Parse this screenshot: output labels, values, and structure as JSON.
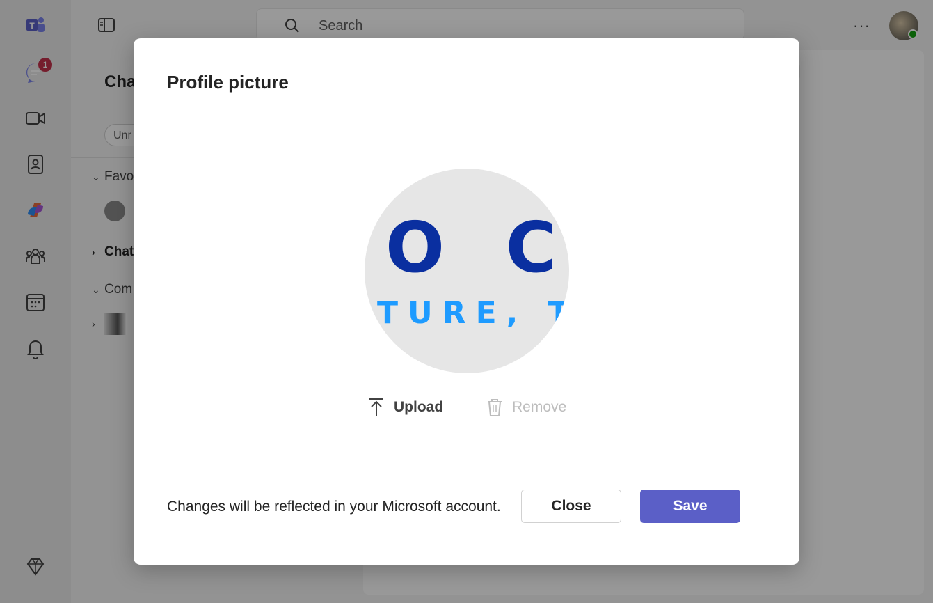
{
  "app": {
    "search": {
      "placeholder": "Search"
    },
    "more_label": "···",
    "chat_panel": {
      "title": "Cha",
      "filter_label": "Unr",
      "sections": [
        {
          "label": "Favo",
          "expanded": true
        },
        {
          "label": "Chat",
          "expanded": false
        },
        {
          "label": "Com",
          "expanded": true
        }
      ]
    },
    "rail": {
      "items": [
        {
          "name": "teams-logo-icon"
        },
        {
          "name": "chat-icon",
          "badge": "1"
        },
        {
          "name": "video-icon"
        },
        {
          "name": "contacts-icon"
        },
        {
          "name": "copilot-icon"
        },
        {
          "name": "communities-icon"
        },
        {
          "name": "calendar-icon"
        },
        {
          "name": "bell-icon"
        },
        {
          "name": "premium-icon"
        }
      ]
    }
  },
  "dialog": {
    "title": "Profile picture",
    "picture_text_line1": "O  C",
    "picture_text_line2": "TURE, T",
    "upload_label": "Upload",
    "remove_label": "Remove",
    "note": "Changes will be reflected in your Microsoft account.",
    "close_label": "Close",
    "save_label": "Save"
  },
  "colors": {
    "accent": "#5b5fc7",
    "badge": "#c4314b",
    "picture_dark_blue": "#0a2fa0",
    "picture_light_blue": "#1e9bff"
  }
}
